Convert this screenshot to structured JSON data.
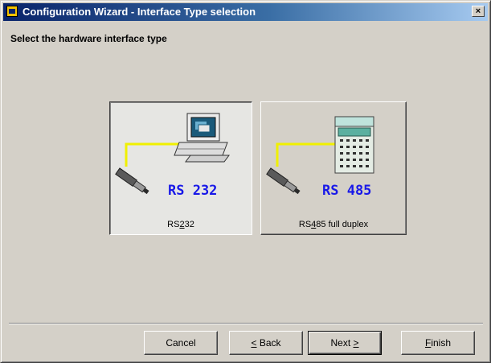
{
  "window": {
    "title": "Configuration Wizard - Interface Type selection",
    "close_label": "×",
    "heading": "Select the hardware interface type"
  },
  "options": [
    {
      "big_label": "RS 232",
      "caption_pre": "RS",
      "caption_underline": "2",
      "caption_post": "32",
      "selected": true,
      "icon": "computer-icon"
    },
    {
      "big_label": "RS 485",
      "caption_pre": "RS",
      "caption_underline": "4",
      "caption_post": "85 full duplex",
      "selected": false,
      "icon": "plc-device-icon"
    }
  ],
  "buttons": {
    "cancel": {
      "label": "Cancel"
    },
    "back": {
      "underline": "<",
      "post": " Back"
    },
    "next": {
      "pre": "Next ",
      "underline": ">"
    },
    "finish": {
      "underline": "F",
      "post": "inish"
    }
  },
  "colors": {
    "title_start": "#0a246a",
    "title_end": "#a6caf0",
    "cable": "#f0f000",
    "label_blue": "#1818e8",
    "dialog_bg": "#d4d0c8"
  }
}
